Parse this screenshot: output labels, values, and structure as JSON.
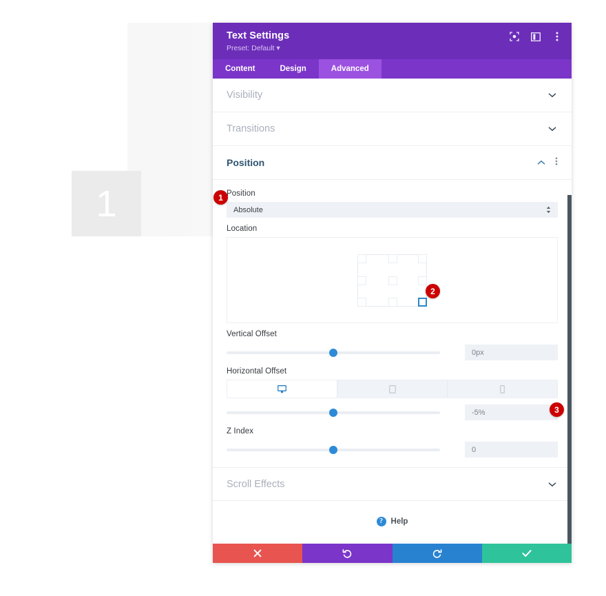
{
  "background": {
    "number_box_label": "1"
  },
  "modal": {
    "title": "Text Settings",
    "preset": "Preset: Default ▾",
    "header_icons": [
      {
        "name": "focus-target-icon"
      },
      {
        "name": "panel-layout-icon"
      },
      {
        "name": "more-options-icon"
      }
    ],
    "tabs": [
      {
        "label": "Content",
        "active": false
      },
      {
        "label": "Design",
        "active": false
      },
      {
        "label": "Advanced",
        "active": true
      }
    ],
    "sections": [
      {
        "label": "Visibility",
        "open": false
      },
      {
        "label": "Transitions",
        "open": false
      },
      {
        "label": "Position",
        "open": true
      },
      {
        "label": "Scroll Effects",
        "open": false
      }
    ],
    "position_section": {
      "position_label": "Position",
      "position_value": "Absolute",
      "location_label": "Location",
      "location_selected": "bottom-right",
      "vertical_offset": {
        "label": "Vertical Offset",
        "value": "0px",
        "thumb_percent": 50
      },
      "horizontal_offset": {
        "label": "Horizontal Offset",
        "value": "-5%",
        "thumb_percent": 50,
        "devices": [
          {
            "name": "desktop-icon",
            "active": true
          },
          {
            "name": "tablet-icon",
            "active": false
          },
          {
            "name": "phone-icon",
            "active": false
          }
        ]
      },
      "z_index": {
        "label": "Z Index",
        "value": "0",
        "thumb_percent": 50
      }
    },
    "help": {
      "label": "Help",
      "icon": "question-mark-icon"
    },
    "footer_buttons": [
      {
        "name": "cancel-button",
        "icon": "close-icon"
      },
      {
        "name": "undo-button",
        "icon": "undo-arrow-icon"
      },
      {
        "name": "redo-button",
        "icon": "redo-arrow-icon"
      },
      {
        "name": "save-button",
        "icon": "checkmark-icon"
      }
    ]
  },
  "badges": [
    {
      "id": "1",
      "label": "1"
    },
    {
      "id": "2",
      "label": "2"
    },
    {
      "id": "3",
      "label": "3"
    }
  ],
  "colors": {
    "header_purple": "#6c2eb9",
    "tabbar_purple": "#7b35c9",
    "tab_active_purple": "#9b52e0",
    "accent_blue": "#2e8ad6",
    "badge_red": "#cc0000",
    "cancel_red": "#e8544f",
    "save_green": "#2fc39b"
  }
}
